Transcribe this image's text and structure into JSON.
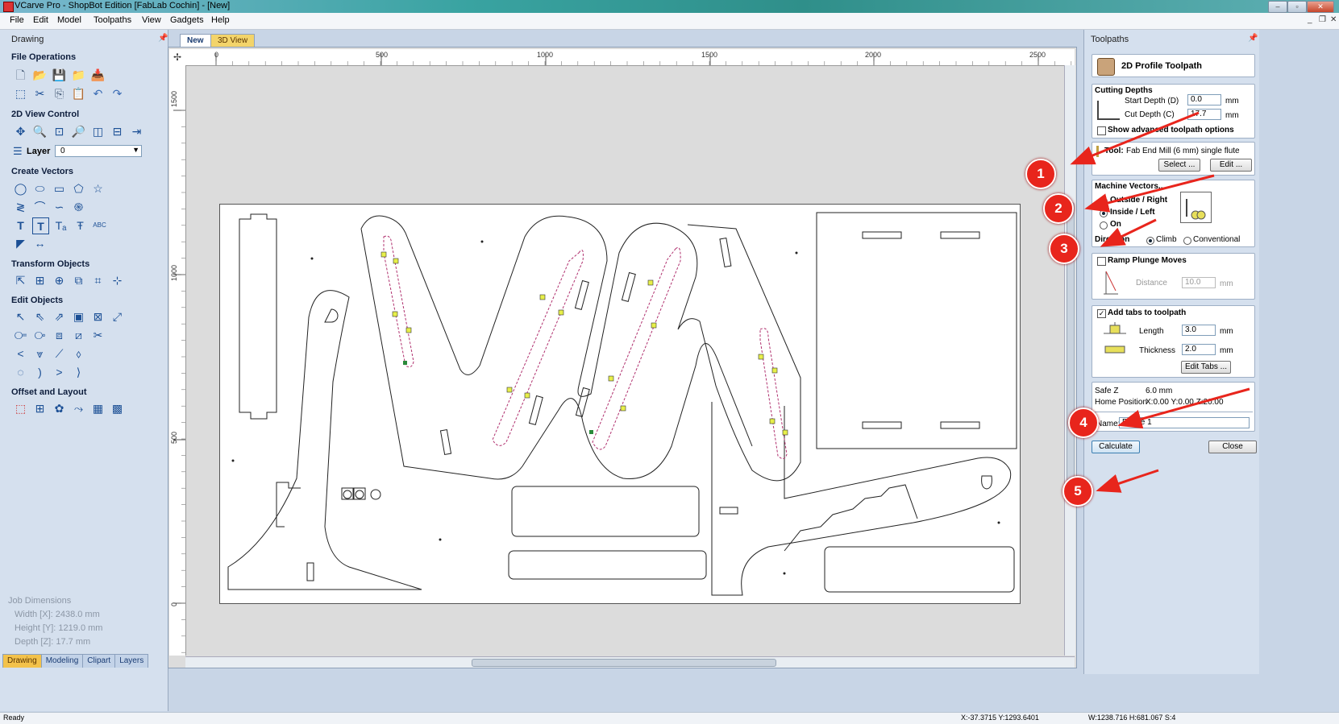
{
  "window": {
    "title": "VCarve Pro - ShopBot Edition [FabLab Cochin] - [New]"
  },
  "menu": [
    "File",
    "Edit",
    "Model",
    "Toolpaths",
    "View",
    "Gadgets",
    "Help"
  ],
  "left_panel": {
    "title": "Drawing",
    "sections": {
      "file_ops": "File Operations",
      "view_control": "2D View Control",
      "create_vectors": "Create Vectors",
      "transform": "Transform Objects",
      "edit_objects": "Edit Objects",
      "offset_layout": "Offset and Layout"
    },
    "layer_label": "Layer",
    "layer_value": "0",
    "job": {
      "title": "Job Dimensions",
      "width": "Width  [X]: 2438.0 mm",
      "height": "Height [Y]: 1219.0 mm",
      "depth": "Depth  [Z]: 17.7 mm"
    },
    "bottom_tabs": [
      "Drawing",
      "Modeling",
      "Clipart",
      "Layers"
    ]
  },
  "doc_tabs": [
    "New",
    "3D View"
  ],
  "rulers": {
    "h_ticks": [
      "0",
      "500",
      "1000",
      "1500",
      "2000",
      "2500"
    ],
    "v_ticks": [
      "1500",
      "1000",
      "500",
      "0"
    ]
  },
  "right_panel": {
    "title": "Toolpaths",
    "header": "2D Profile Toolpath",
    "cutting_depths": {
      "title": "Cutting Depths",
      "start_label": "Start Depth (D)",
      "start_value": "0.0",
      "cut_label": "Cut Depth (C)",
      "cut_value": "17.7",
      "unit": "mm",
      "advanced": "Show advanced toolpath options"
    },
    "tool": {
      "label": "Tool:",
      "value": "Fab End Mill (6 mm) single flute",
      "select": "Select ...",
      "edit": "Edit ..."
    },
    "machine": {
      "title": "Machine Vectors...",
      "outside": "Outside / Right",
      "inside": "Inside / Left",
      "on": "On",
      "direction": "Direction",
      "climb": "Climb",
      "conventional": "Conventional"
    },
    "ramp": {
      "title": "Ramp Plunge Moves",
      "distance_label": "Distance",
      "distance_value": "10.0",
      "unit": "mm"
    },
    "tabs": {
      "title": "Add tabs to toolpath",
      "length_label": "Length",
      "length_value": "3.0",
      "thickness_label": "Thickness",
      "thickness_value": "2.0",
      "unit": "mm",
      "edit": "Edit Tabs ..."
    },
    "safe": {
      "safe_label": "Safe Z",
      "safe_value": "6.0 mm",
      "home_label": "Home Position",
      "home_value": "X:0.00 Y:0.00 Z:20.00"
    },
    "name_label": "Name:",
    "name_value": "Profile 1",
    "calculate": "Calculate",
    "close": "Close"
  },
  "status": {
    "left": "Ready",
    "coords": "X:-37.3715 Y:1293.6401",
    "size": "W:1238.716  H:681.067  S:4"
  },
  "markers": [
    "1",
    "2",
    "3",
    "4",
    "5"
  ],
  "colors": {
    "marker": "#e8251c",
    "arrow": "#e8251c",
    "active_tab": "#f3c24b",
    "toolpath": "#b0306e"
  }
}
